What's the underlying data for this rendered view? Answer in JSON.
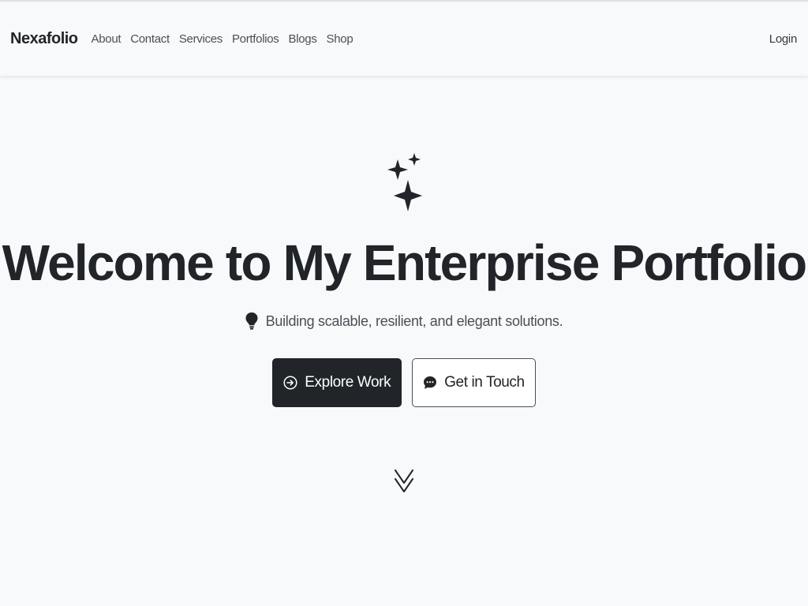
{
  "navbar": {
    "brand": "Nexafolio",
    "links": [
      "About",
      "Contact",
      "Services",
      "Portfolios",
      "Blogs",
      "Shop"
    ],
    "login": "Login"
  },
  "hero": {
    "icon": "stars-icon",
    "title": "Welcome to My Enterprise Portfolio",
    "subtitle_icon": "lightbulb-icon",
    "subtitle": "Building scalable, resilient, and elegant solutions.",
    "primary_button": {
      "label": "Explore Work",
      "icon": "arrow-right-circle-icon"
    },
    "secondary_button": {
      "label": "Get in Touch",
      "icon": "chat-dots-icon"
    },
    "scroll_icon": "chevron-double-down-icon"
  },
  "colors": {
    "background": "#f8f9fa",
    "dark": "#212529",
    "muted": "#495057"
  }
}
